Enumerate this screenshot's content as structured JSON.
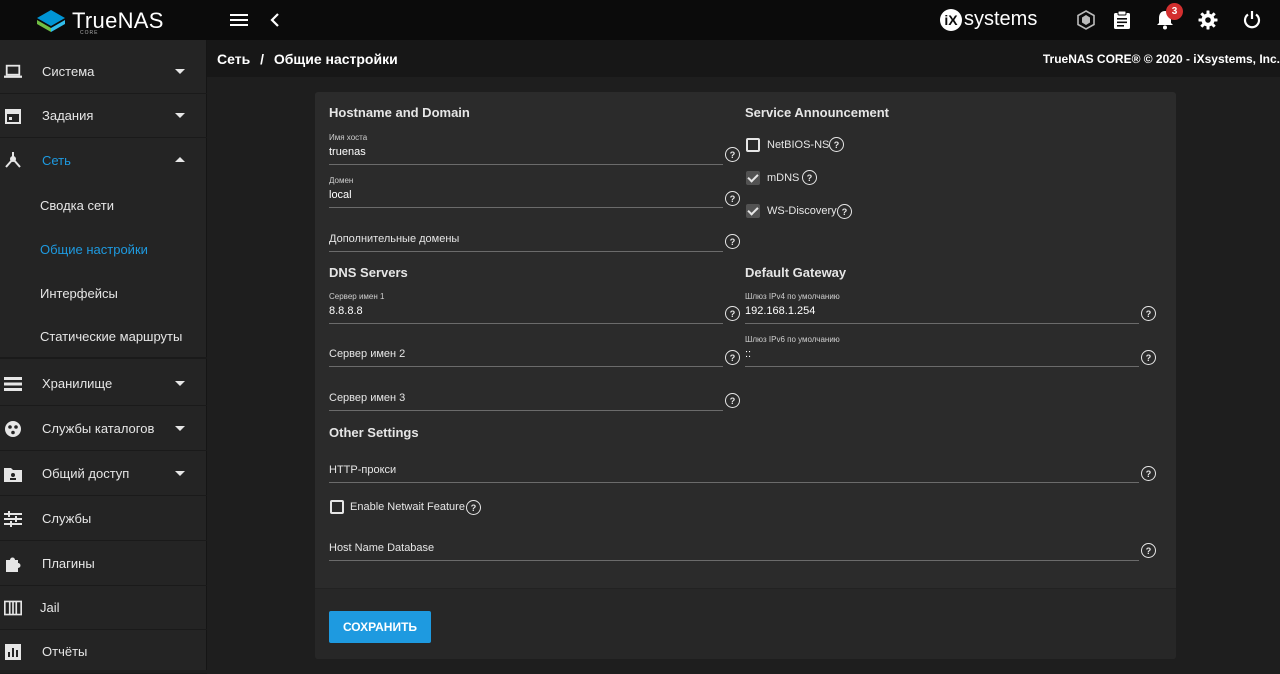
{
  "app": {
    "logo_name": "TrueNAS",
    "logo_sub": "CORE",
    "vendor": "systems",
    "notification_count": "3",
    "copyright": "TrueNAS CORE® © 2020 - iXsystems, Inc."
  },
  "topbar_icons": [
    "menu-icon",
    "chevron-left-icon",
    "truecommand-icon",
    "clipboard-icon",
    "bell-icon",
    "gear-icon",
    "power-icon"
  ],
  "sidebar": {
    "items": [
      {
        "label": "Система",
        "icon": "laptop-icon",
        "arrow": "down"
      },
      {
        "label": "Задания",
        "icon": "calendar-icon",
        "arrow": "down"
      },
      {
        "label": "Сеть",
        "icon": "network-icon",
        "arrow": "up",
        "active": true
      },
      {
        "label": "Хранилище",
        "icon": "storage-icon",
        "arrow": "down"
      },
      {
        "label": "Службы каталогов",
        "icon": "directory-icon",
        "arrow": "down"
      },
      {
        "label": "Общий доступ",
        "icon": "share-folder-icon",
        "arrow": "down"
      },
      {
        "label": "Службы",
        "icon": "sliders-icon",
        "arrow": ""
      },
      {
        "label": "Плагины",
        "icon": "puzzle-icon",
        "arrow": ""
      },
      {
        "label": "Jail",
        "icon": "jail-icon",
        "arrow": ""
      },
      {
        "label": "Отчёты",
        "icon": "reports-icon",
        "arrow": ""
      }
    ],
    "subitems": [
      {
        "label": "Сводка сети"
      },
      {
        "label": "Общие настройки",
        "active": true
      },
      {
        "label": "Интерфейсы"
      },
      {
        "label": "Статические маршруты"
      }
    ]
  },
  "breadcrumb": {
    "parent": "Сеть",
    "separator": "/",
    "current": "Общие настройки"
  },
  "form": {
    "hostname_section": "Hostname and Domain",
    "hostname_label": "Имя хоста",
    "hostname_value": "truenas",
    "domain_label": "Домен",
    "domain_value": "local",
    "additional_domains_placeholder": "Дополнительные домены",
    "service_section": "Service Announcement",
    "netbios_label": "NetBIOS-NS",
    "netbios_checked": false,
    "mdns_label": "mDNS",
    "mdns_checked": true,
    "wsd_label": "WS-Discovery",
    "wsd_checked": true,
    "dns_section": "DNS Servers",
    "ns1_label": "Сервер имен 1",
    "ns1_value": "8.8.8.8",
    "ns2_placeholder": "Сервер имен 2",
    "ns3_placeholder": "Сервер имен 3",
    "gateway_section": "Default Gateway",
    "ipv4_label": "Шлюз IPv4 по умолчанию",
    "ipv4_value": "192.168.1.254",
    "ipv6_label": "Шлюз IPv6 по умолчанию",
    "ipv6_value": "::",
    "other_section": "Other Settings",
    "http_proxy_placeholder": "HTTP-прокси",
    "netwait_label": "Enable Netwait Feature",
    "netwait_checked": false,
    "host_db_placeholder": "Host Name Database",
    "save_label": "СОХРАНИТЬ"
  },
  "colors": {
    "accent": "#1e9ae0",
    "topbar": "#0b0b0b",
    "sidebar": "#242424",
    "card": "#2b2b2b",
    "badge": "#d32f2f"
  }
}
